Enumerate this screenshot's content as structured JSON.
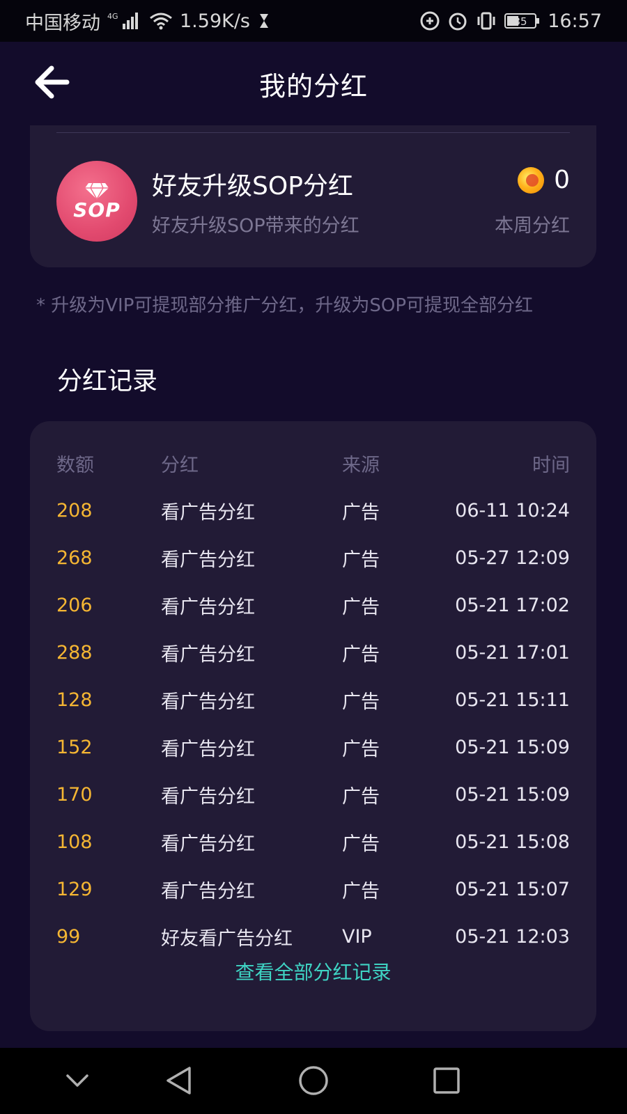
{
  "status_bar": {
    "carrier": "中国移动",
    "network": "4G",
    "speed": "1.59K/s",
    "battery": "35",
    "time": "16:57"
  },
  "header": {
    "title": "我的分红",
    "back_icon": "arrow-left-icon"
  },
  "sop_card": {
    "logo_text": "SOP",
    "title": "好友升级SOP分红",
    "subtitle": "好友升级SOP带来的分红",
    "amount": "0",
    "amount_label": "本周分红",
    "coin_icon": "coin-icon"
  },
  "note": "* 升级为VIP可提现部分推广分红，升级为SOP可提现全部分红",
  "records": {
    "section_title": "分红记录",
    "columns": [
      "数额",
      "分红",
      "来源",
      "时间"
    ],
    "rows": [
      {
        "amount": "208",
        "type": "看广告分红",
        "source": "广告",
        "time": "06-11 10:24"
      },
      {
        "amount": "268",
        "type": "看广告分红",
        "source": "广告",
        "time": "05-27 12:09"
      },
      {
        "amount": "206",
        "type": "看广告分红",
        "source": "广告",
        "time": "05-21 17:02"
      },
      {
        "amount": "288",
        "type": "看广告分红",
        "source": "广告",
        "time": "05-21 17:01"
      },
      {
        "amount": "128",
        "type": "看广告分红",
        "source": "广告",
        "time": "05-21 15:11"
      },
      {
        "amount": "152",
        "type": "看广告分红",
        "source": "广告",
        "time": "05-21 15:09"
      },
      {
        "amount": "170",
        "type": "看广告分红",
        "source": "广告",
        "time": "05-21 15:09"
      },
      {
        "amount": "108",
        "type": "看广告分红",
        "source": "广告",
        "time": "05-21 15:08"
      },
      {
        "amount": "129",
        "type": "看广告分红",
        "source": "广告",
        "time": "05-21 15:07"
      },
      {
        "amount": "99",
        "type": "好友看广告分红",
        "source": "VIP",
        "time": "05-21 12:03"
      }
    ],
    "view_all": "查看全部分红记录"
  },
  "colors": {
    "background": "#130c2b",
    "card": "#221b36",
    "amount": "#f5b633",
    "link": "#3fd4c4",
    "muted": "#6e6889"
  }
}
